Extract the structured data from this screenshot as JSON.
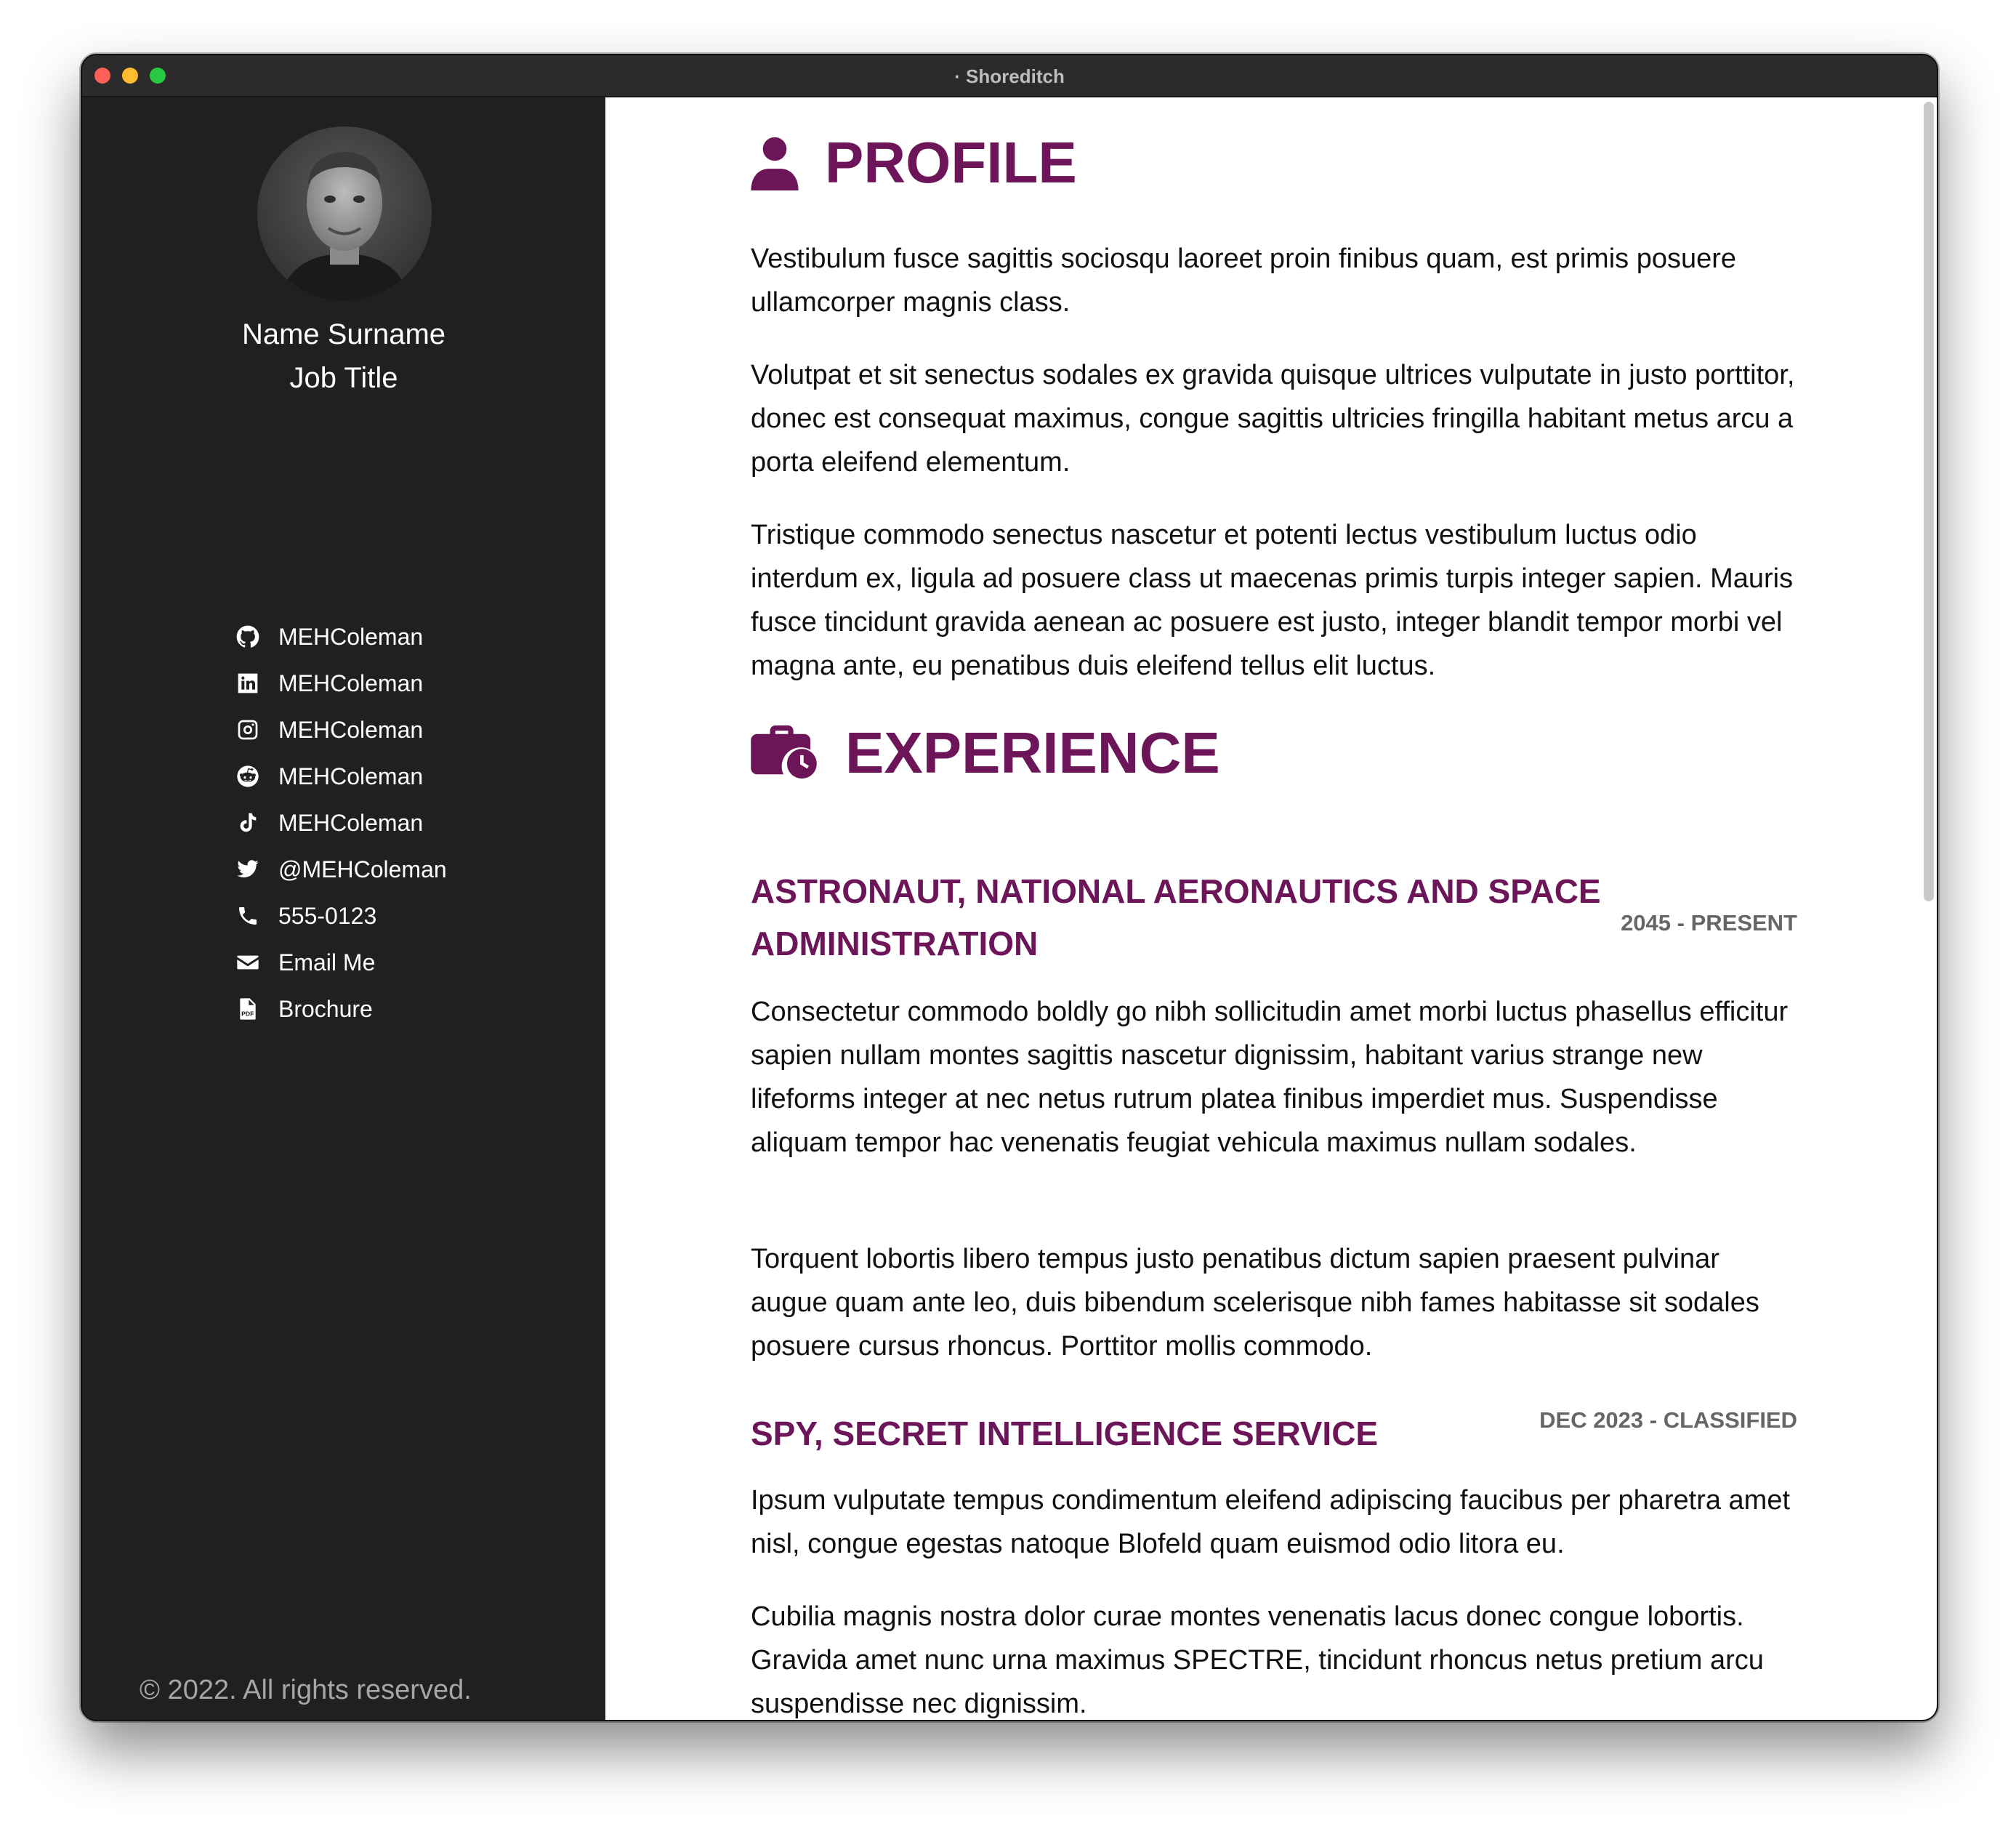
{
  "window": {
    "title": "· Shoreditch"
  },
  "sidebar": {
    "name": "Name Surname",
    "job_title": "Job Title",
    "links": [
      {
        "icon": "github-icon",
        "label": "MEHColeman"
      },
      {
        "icon": "linkedin-icon",
        "label": "MEHColeman"
      },
      {
        "icon": "instagram-icon",
        "label": "MEHColeman"
      },
      {
        "icon": "reddit-icon",
        "label": "MEHColeman"
      },
      {
        "icon": "tiktok-icon",
        "label": "MEHColeman"
      },
      {
        "icon": "twitter-icon",
        "label": "@MEHColeman"
      },
      {
        "icon": "phone-icon",
        "label": "555-0123"
      },
      {
        "icon": "envelope-icon",
        "label": "Email Me"
      },
      {
        "icon": "pdf-file-icon",
        "label": "Brochure"
      }
    ],
    "copyright": "© 2022. All rights reserved."
  },
  "profile": {
    "heading": "PROFILE",
    "paragraphs": [
      "Vestibulum fusce sagittis sociosqu laoreet proin finibus quam, est primis posuere ullamcorper magnis class.",
      "Volutpat et sit senectus sodales ex gravida quisque ultrices vulputate in justo porttitor, donec est consequat maximus, congue sagittis ultricies fringilla habitant metus arcu a porta eleifend elementum.",
      "Tristique commodo senectus nascetur et potenti lectus vestibulum luctus odio interdum ex, ligula ad posuere class ut maecenas primis turpis integer sapien. Mauris fusce tincidunt gravida aenean ac posuere est justo, integer blandit tempor morbi vel magna ante, eu penatibus duis eleifend tellus elit luctus."
    ]
  },
  "experience": {
    "heading": "EXPERIENCE",
    "jobs": [
      {
        "title": "ASTRONAUT, NATIONAL AERONAUTICS AND SPACE ADMINISTRATION",
        "dates": "2045 - PRESENT",
        "paragraphs": [
          "Consectetur commodo boldly go nibh sollicitudin amet morbi luctus phasellus efficitur sapien nullam montes sagittis nascetur dignissim, habitant varius strange new lifeforms integer at nec netus rutrum platea finibus imperdiet mus. Suspendisse aliquam tempor hac venenatis feugiat vehicula maximus nullam sodales.",
          "Torquent lobortis libero tempus justo penatibus dictum sapien praesent pulvinar augue quam ante leo, duis bibendum scelerisque nibh fames habitasse sit sodales posuere cursus rhoncus. Porttitor mollis commodo."
        ]
      },
      {
        "title": "SPY, SECRET INTELLIGENCE SERVICE",
        "dates": "DEC 2023 - CLASSIFIED",
        "paragraphs": [
          "Ipsum vulputate tempus condimentum eleifend adipiscing faucibus per pharetra amet nisl, congue egestas natoque Blofeld quam euismod odio litora eu.",
          "Cubilia magnis nostra dolor curae montes venenatis lacus donec congue lobortis. Gravida amet nunc urna maximus SPECTRE, tincidunt rhoncus netus pretium arcu suspendisse nec dignissim."
        ]
      }
    ]
  },
  "colors": {
    "accent": "#6c1558",
    "sidebar_bg": "#202020",
    "date_gray": "#666666"
  }
}
